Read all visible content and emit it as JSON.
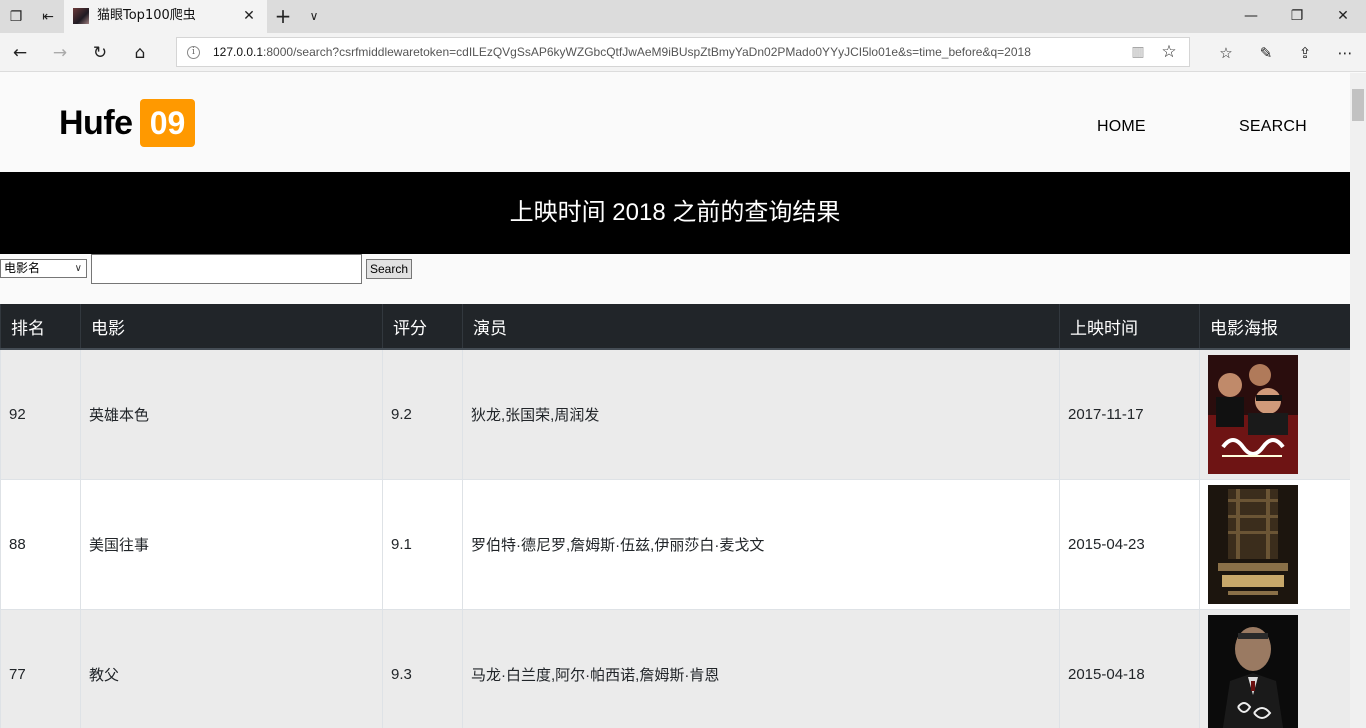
{
  "browser": {
    "tab_title": "猫眼Top100爬虫",
    "url_host": "127.0.0.1",
    "url_rest": ":8000/search?csrfmiddlewaretoken=cdILEzQVgSsAP6kyWZGbcQtfJwAeM9iBUspZtBmyYaDn02PMado0YYyJCI5lo01e&s=time_before&q=2018"
  },
  "site": {
    "logo_text": "Hufe",
    "logo_badge": "09",
    "nav": {
      "home": "HOME",
      "search": "SEARCH"
    },
    "banner_title": "上映时间 2018 之前的查询结果",
    "colors": {
      "accent": "#ff9900",
      "banner": "#000000",
      "table_header": "#212529"
    }
  },
  "search": {
    "select_value": "电影名",
    "input_value": "",
    "button_label": "Search"
  },
  "table": {
    "headers": [
      "排名",
      "电影",
      "评分",
      "演员",
      "上映时间",
      "电影海报"
    ],
    "rows": [
      {
        "rank": "92",
        "movie": "英雄本色",
        "score": "9.2",
        "actors": "狄龙,张国荣,周润发",
        "date": "2017-11-17",
        "poster_poster_text": "英雄本色"
      },
      {
        "rank": "88",
        "movie": "美国往事",
        "score": "9.1",
        "actors": "罗伯特·德尼罗,詹姆斯·伍兹,伊丽莎白·麦戈文",
        "date": "2015-04-23",
        "poster_poster_text": "AMERICA"
      },
      {
        "rank": "77",
        "movie": "教父",
        "score": "9.3",
        "actors": "马龙·白兰度,阿尔·帕西诺,詹姆斯·肯恩",
        "date": "2015-04-18",
        "poster_poster_text": "The Godfather"
      }
    ]
  }
}
